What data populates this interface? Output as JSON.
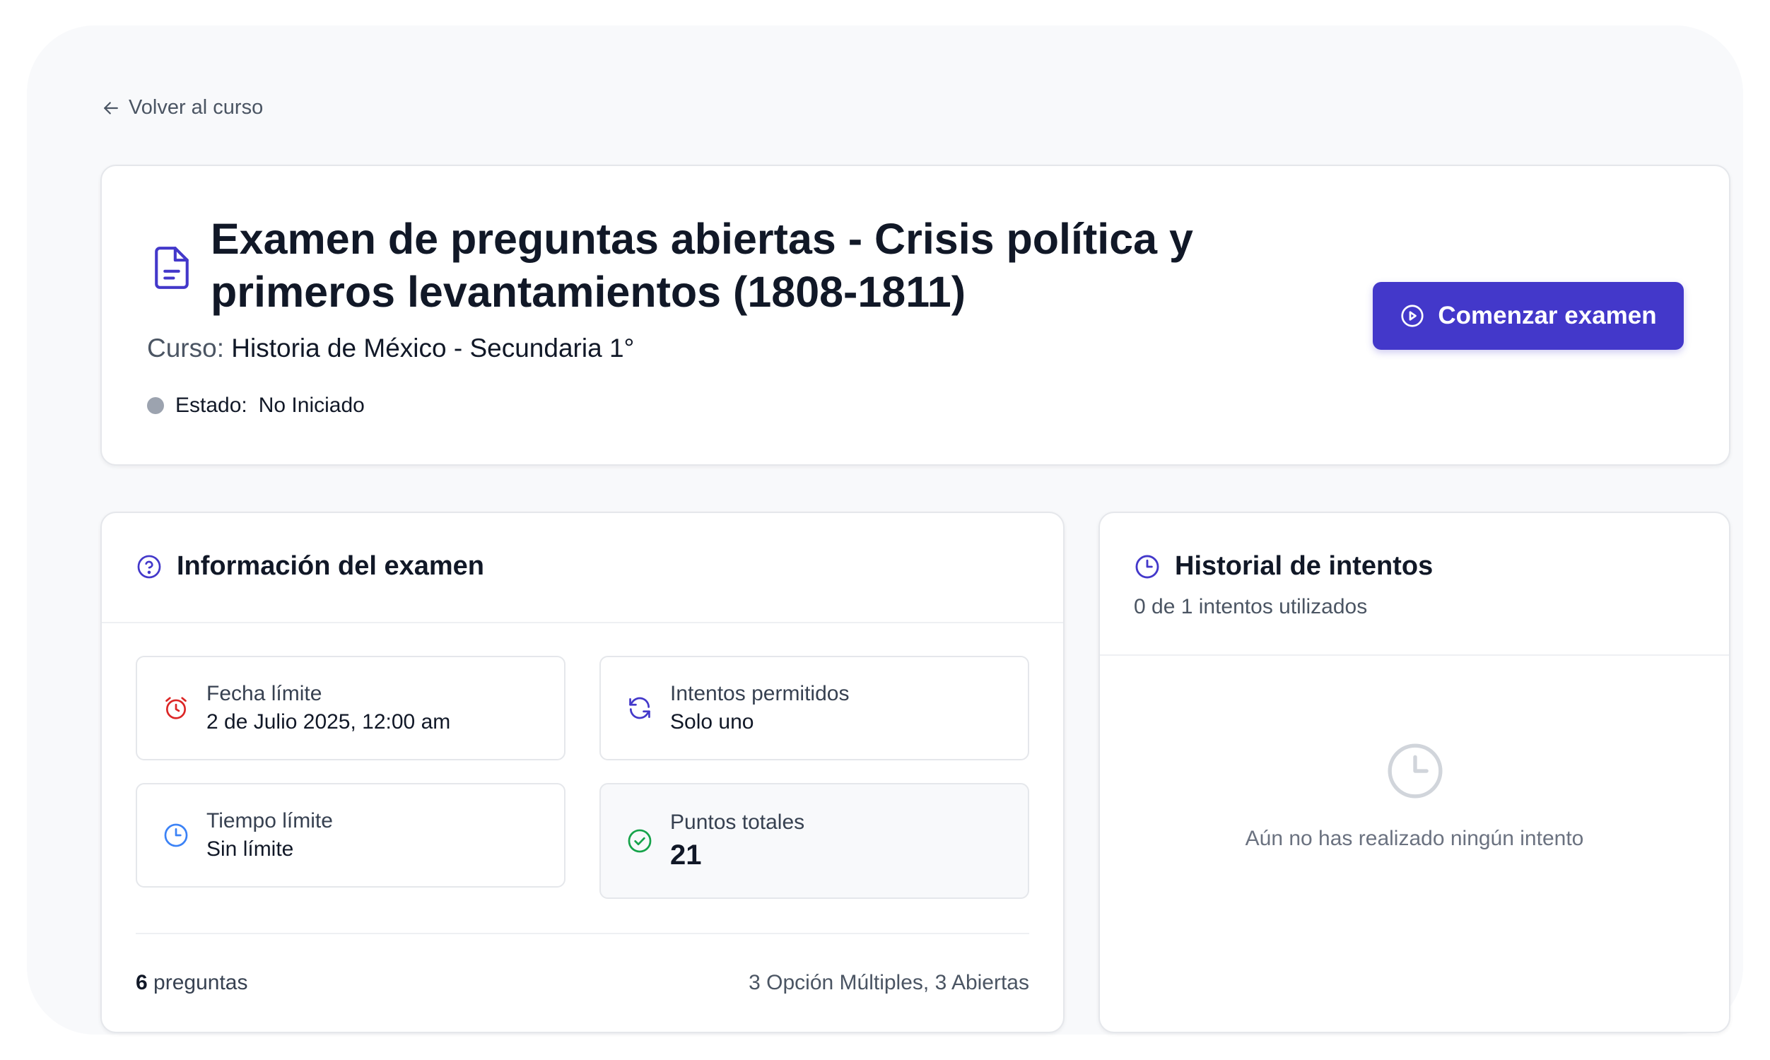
{
  "nav": {
    "back_label": "Volver al curso"
  },
  "exam": {
    "title": "Examen de preguntas abiertas - Crisis política y primeros levantamientos (1808-1811)",
    "course_label": "Curso:",
    "course_name": "Historia de México - Secundaria 1°",
    "status_label": "Estado:",
    "status_value": "No Iniciado",
    "start_button": "Comenzar examen"
  },
  "info": {
    "title": "Información del examen",
    "tiles": [
      {
        "label": "Fecha límite",
        "value": "2 de Julio 2025, 12:00 am",
        "icon": "alarm-clock-icon"
      },
      {
        "label": "Intentos permitidos",
        "value": "Solo uno",
        "icon": "refresh-icon"
      },
      {
        "label": "Tiempo límite",
        "value": "Sin límite",
        "icon": "clock-icon"
      },
      {
        "label": "Puntos totales",
        "value": "21",
        "icon": "check-circle-icon"
      }
    ],
    "question_count": "6",
    "question_word": "preguntas",
    "question_breakdown": "3 Opción Múltiples, 3 Abiertas"
  },
  "history": {
    "title": "Historial de intentos",
    "subtitle": "0 de 1 intentos utilizados",
    "empty_message": "Aún no has realizado ningún intento"
  },
  "colors": {
    "accent": "#4338ca",
    "page_bg": "#f8f9fb",
    "deadline_icon": "#dc2626",
    "time_icon": "#3b82f6",
    "points_icon": "#16a34a",
    "status_dot": "#9ca3af"
  }
}
